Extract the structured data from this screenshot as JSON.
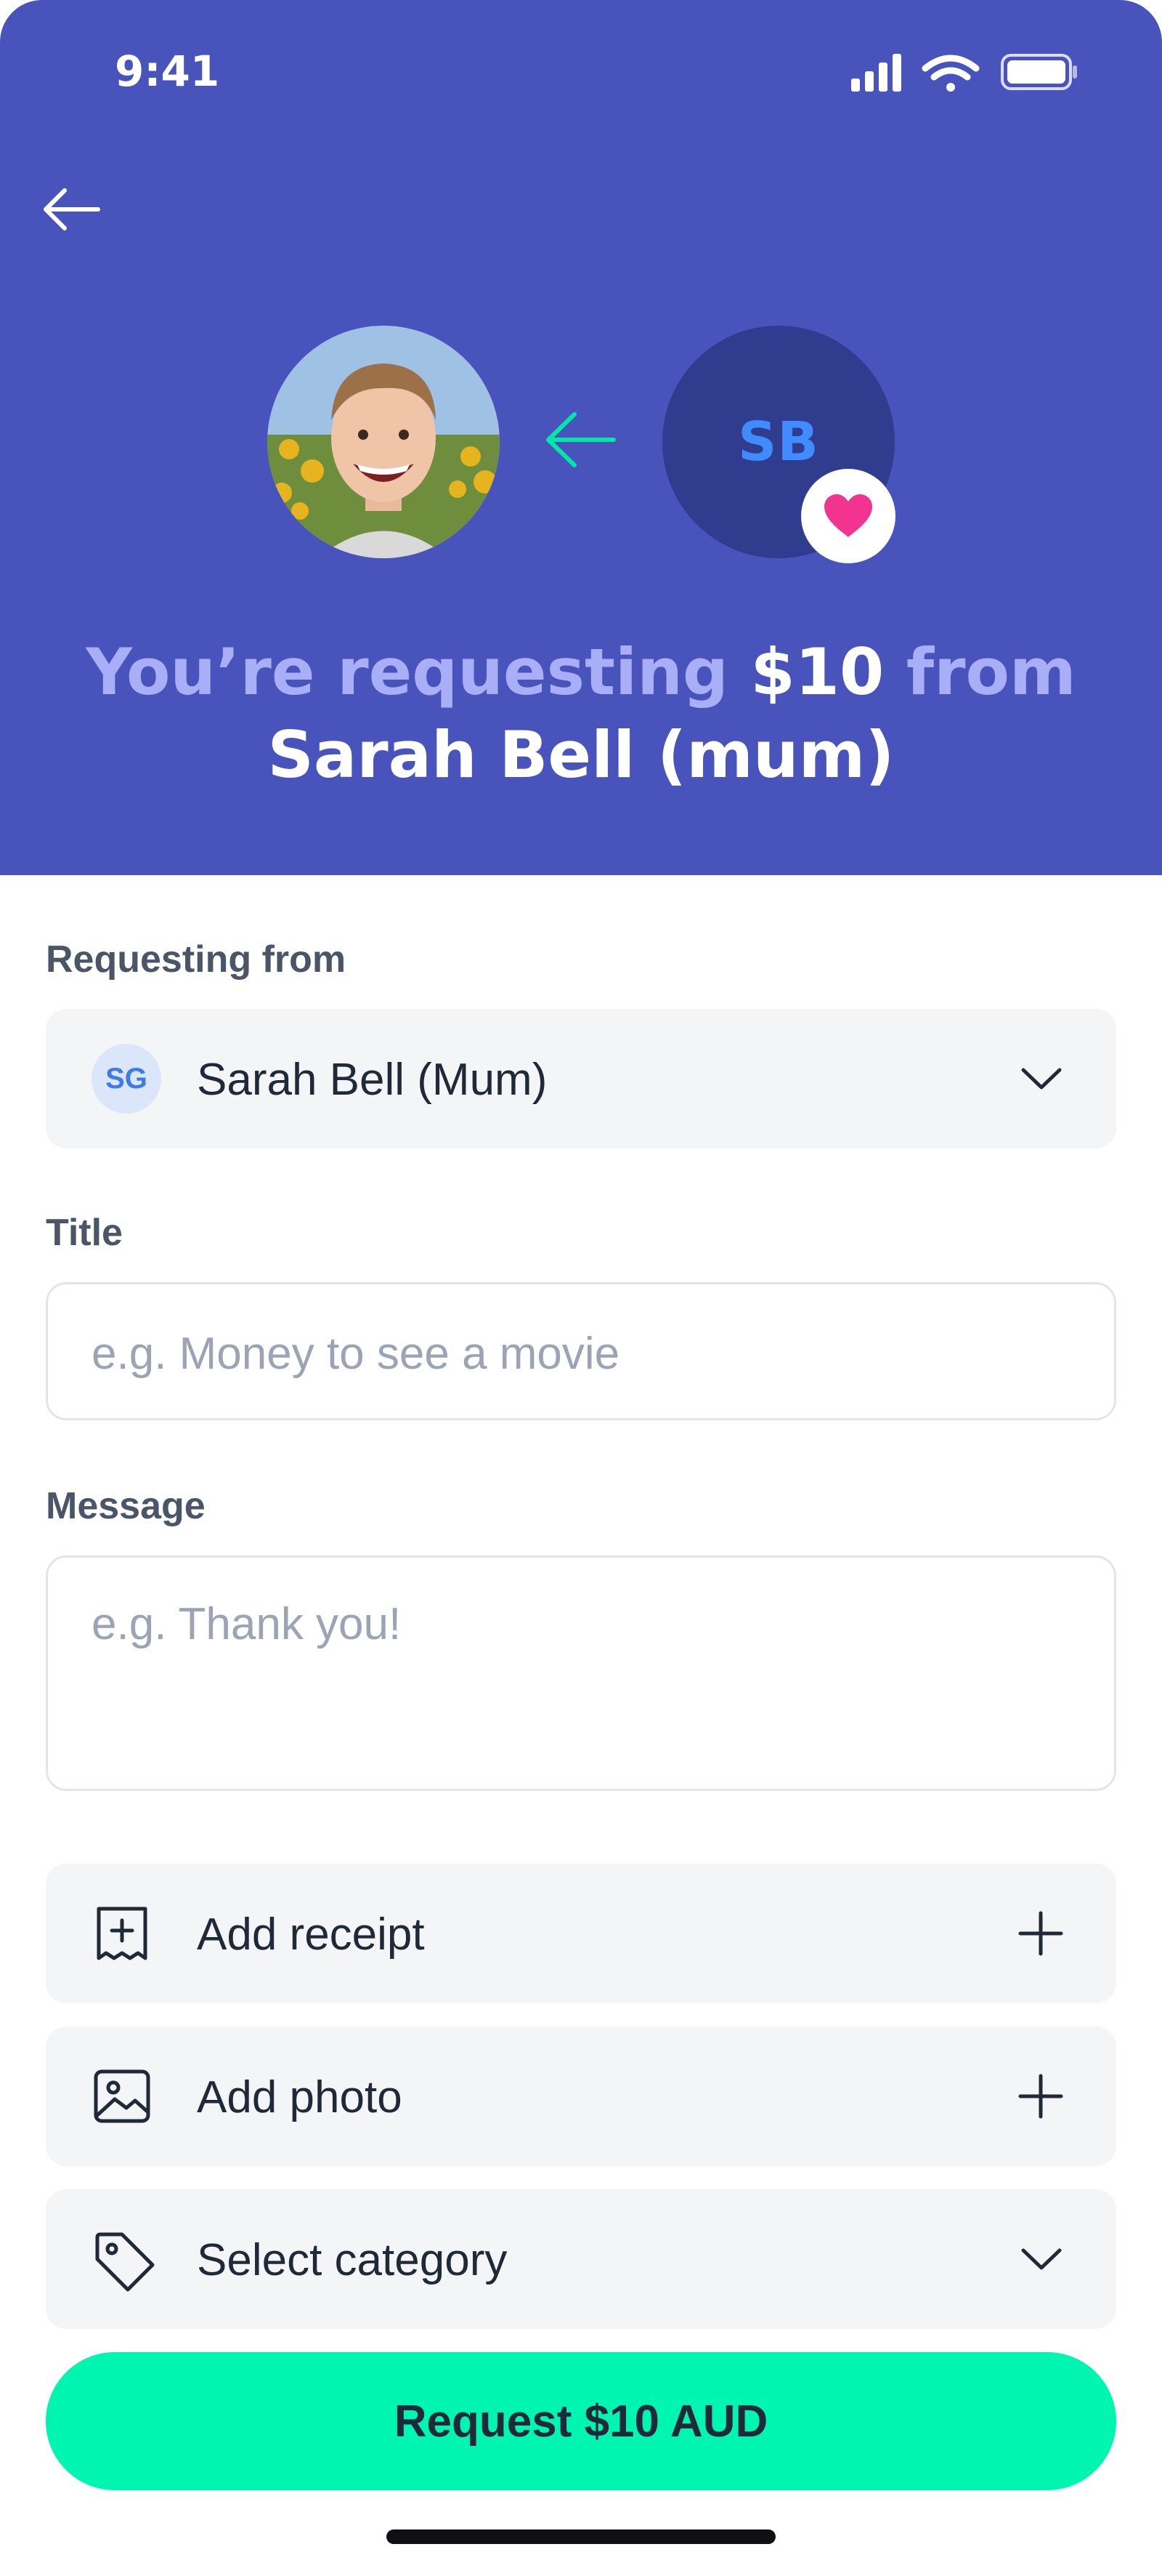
{
  "status_bar": {
    "time": "9:41"
  },
  "header": {
    "requester_photo": "child-avatar",
    "recipient_initials": "SB",
    "headline_part1": "You’re requesting",
    "amount": "$10",
    "headline_part2": "from",
    "recipient_name": "Sarah Bell (mum)"
  },
  "form": {
    "requesting_from_label": "Requesting from",
    "requesting_from_initials": "SG",
    "requesting_from_value": "Sarah Bell (Mum)",
    "title_label": "Title",
    "title_placeholder": "e.g. Money to see a movie",
    "message_label": "Message",
    "message_placeholder": "e.g. Thank you!"
  },
  "actions": {
    "add_receipt": "Add receipt",
    "add_photo": "Add photo",
    "select_category": "Select category"
  },
  "cta": {
    "label": "Request $10 AUD"
  },
  "colors": {
    "header_bg": "#4854BC",
    "accent": "#00F5B0",
    "heart": "#F0348F",
    "avatar_bg": "#303C8D"
  }
}
